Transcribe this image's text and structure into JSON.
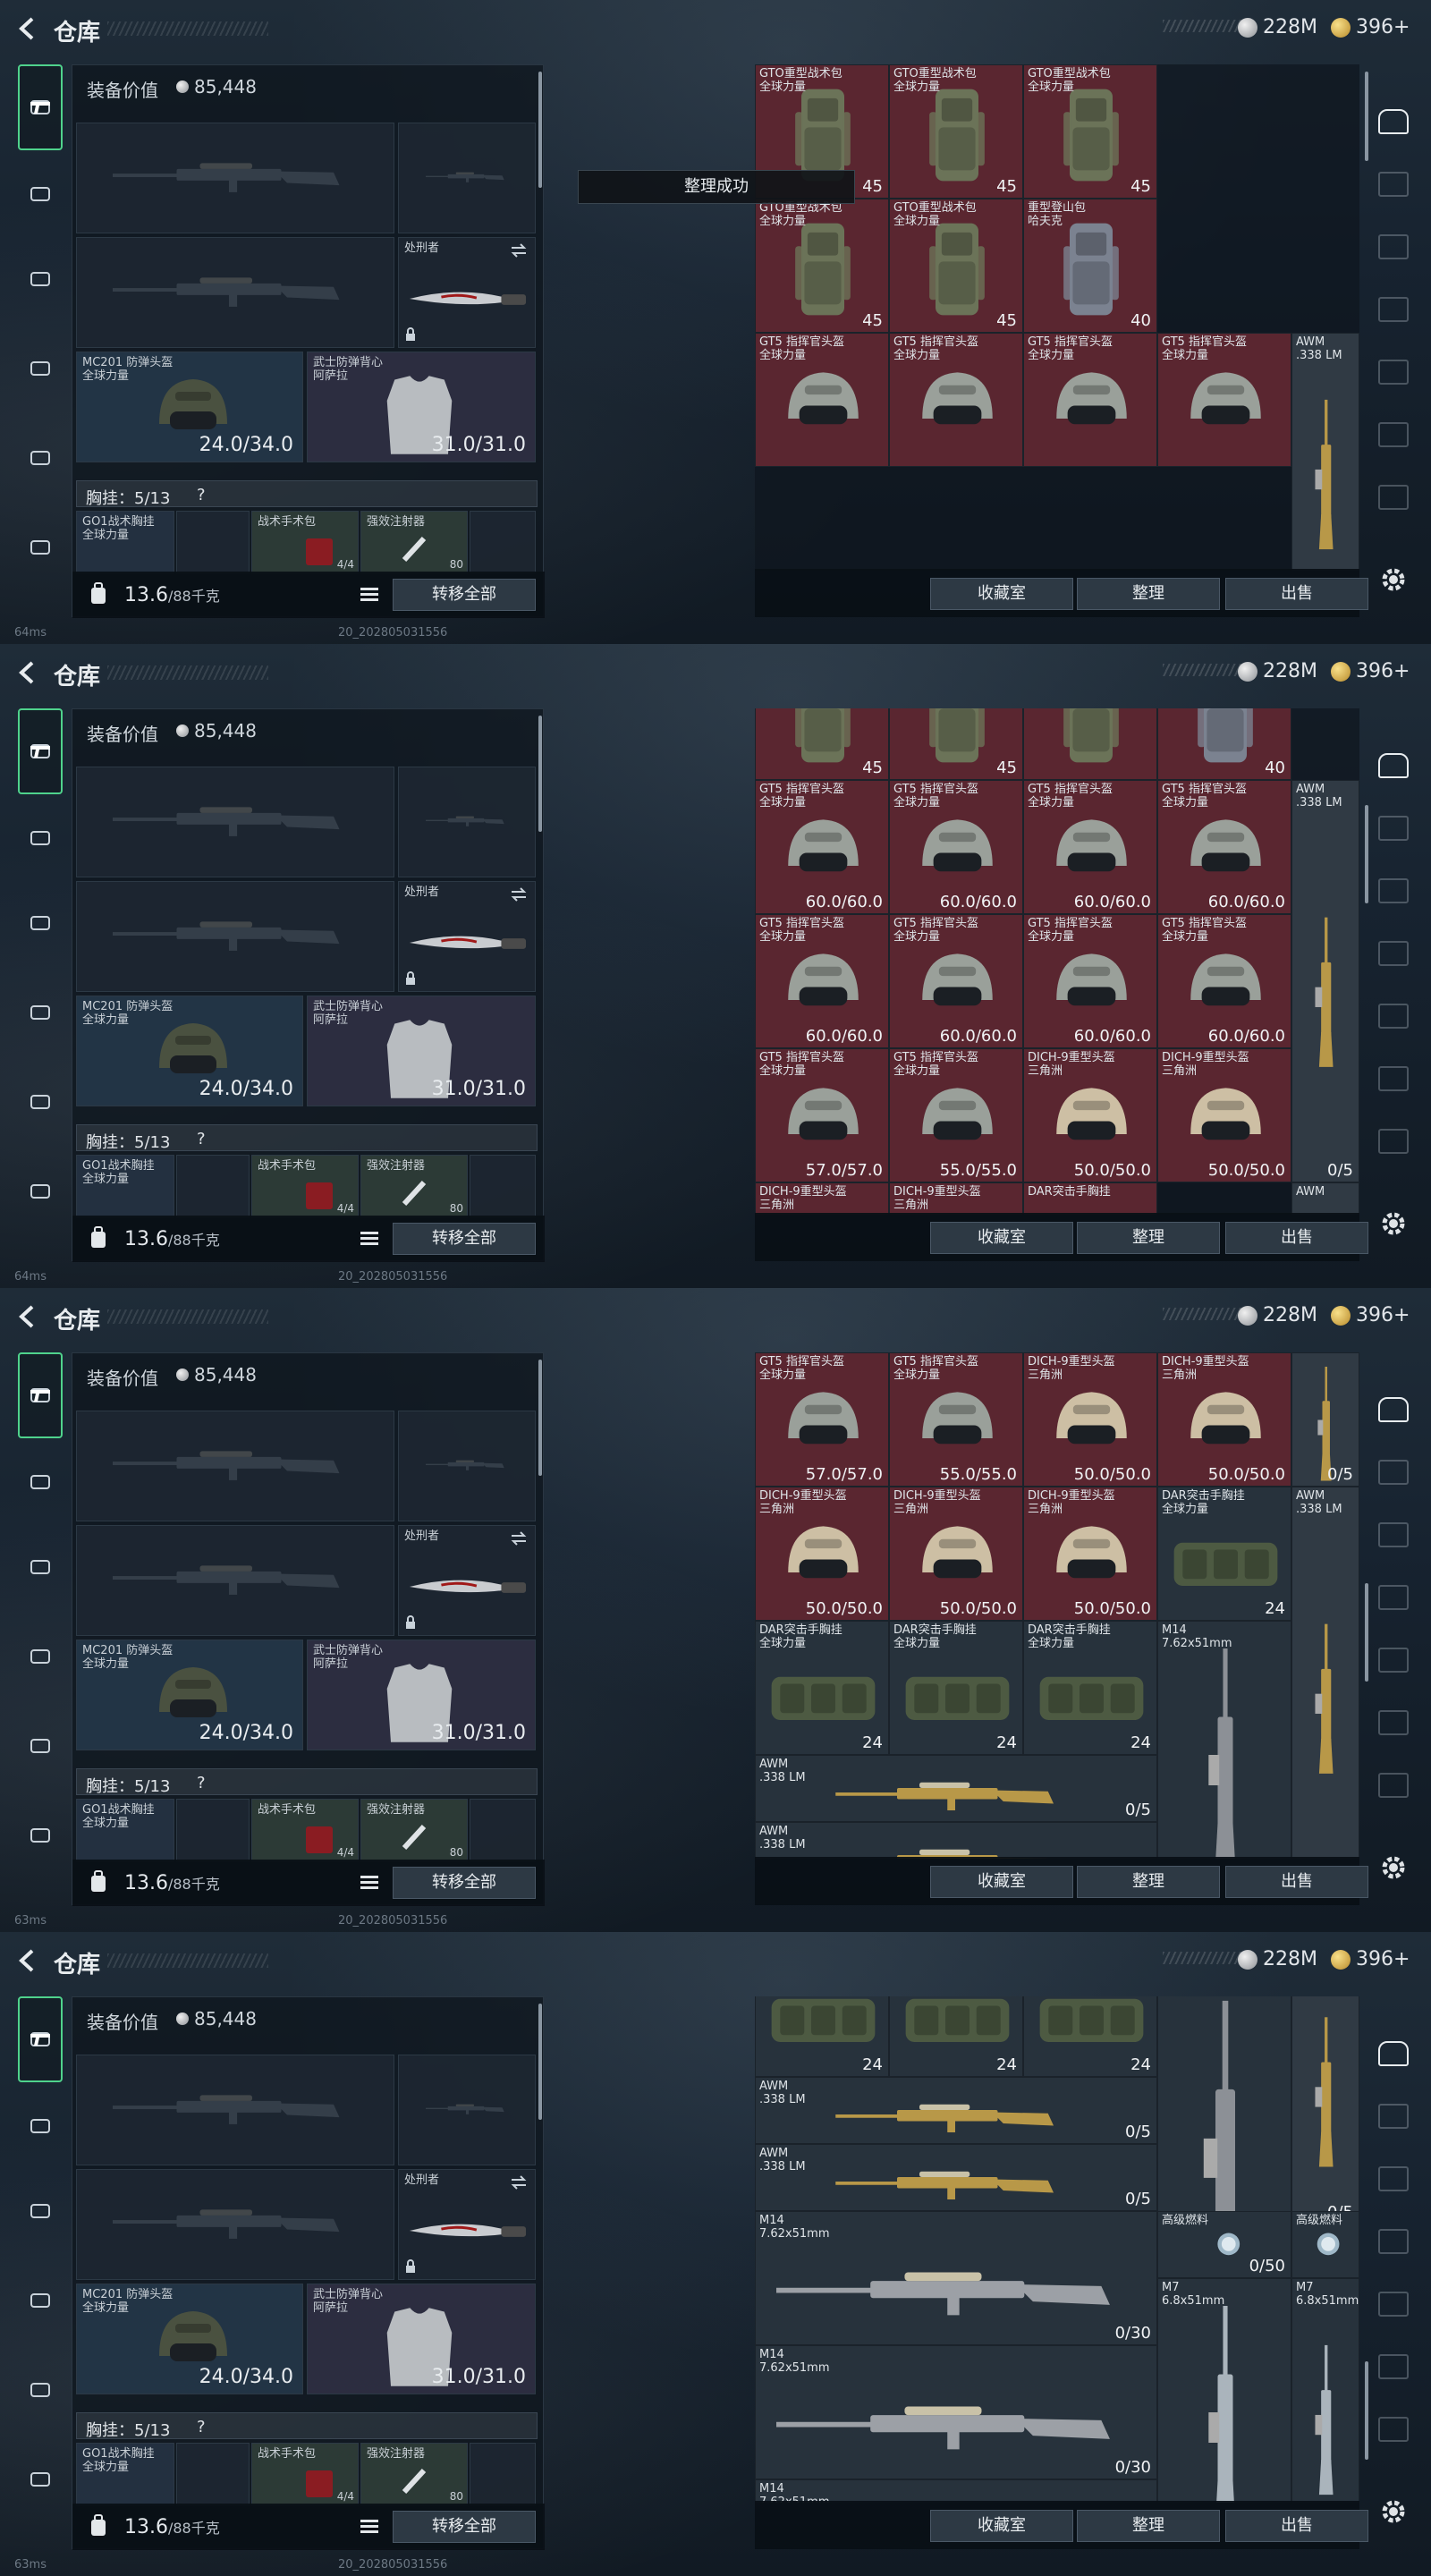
{
  "header": {
    "title": "仓库",
    "currency_silver": "228M",
    "currency_gold": "396+"
  },
  "equipment": {
    "value_label": "装备价值",
    "value": "85,448",
    "melee_name": "处刑者",
    "helmet_name": "MC201 防弹头盔",
    "helmet_sub": "全球力量",
    "helmet_dur": "24.0/34.0",
    "vest_name": "武士防弹背心",
    "vest_sub": "阿萨拉",
    "vest_dur": "31.0/31.0",
    "chest_label": "胸挂：5/13",
    "chest_help": "?",
    "rig_name": "GO1战术胸挂",
    "rig_sub": "全球力量",
    "pouch_name": "战术手术包",
    "pouch_count": "4/4",
    "injector_name": "强效注射器",
    "injector_count": "80",
    "weight": "13.6",
    "weight_max": "/88千克",
    "transfer_label": "转移全部"
  },
  "actions": {
    "collection": "收藏室",
    "organize": "整理",
    "sell": "出售"
  },
  "toast": "整理成功",
  "status": {
    "ping_1": "64ms",
    "ping_2": "64ms",
    "ping_3": "63ms",
    "ping_4": "63ms",
    "build": "20_202805031556"
  },
  "items": {
    "gto_name": "GTO重型战术包",
    "gto_sub": "全球力量",
    "mountain_name": "重型登山包",
    "mountain_sub": "哈夫克",
    "gt5_name": "GT5 指挥官头盔",
    "gt5_sub": "全球力量",
    "dich_name": "DICH-9重型头盔",
    "dich_sub": "三角洲",
    "dar_name": "DAR突击手胸挂",
    "dar_sub": "全球力量",
    "awm_name": "AWM",
    "awm_sub": ".338 LM",
    "m14_name": "M14",
    "m14_sub": "7.62x51mm",
    "m7_name": "M7",
    "m7_sub": "6.8x51mm",
    "fuel_name": "高级燃料",
    "v45": "45",
    "v40": "40",
    "v24": "24",
    "d600": "60.0/60.0",
    "d570": "57.0/57.0",
    "d550": "55.0/55.0",
    "d500": "50.0/50.0",
    "ammo_0_5": "0/5",
    "ammo_0_50": "0/50",
    "ammo_0_30": "0/30"
  }
}
